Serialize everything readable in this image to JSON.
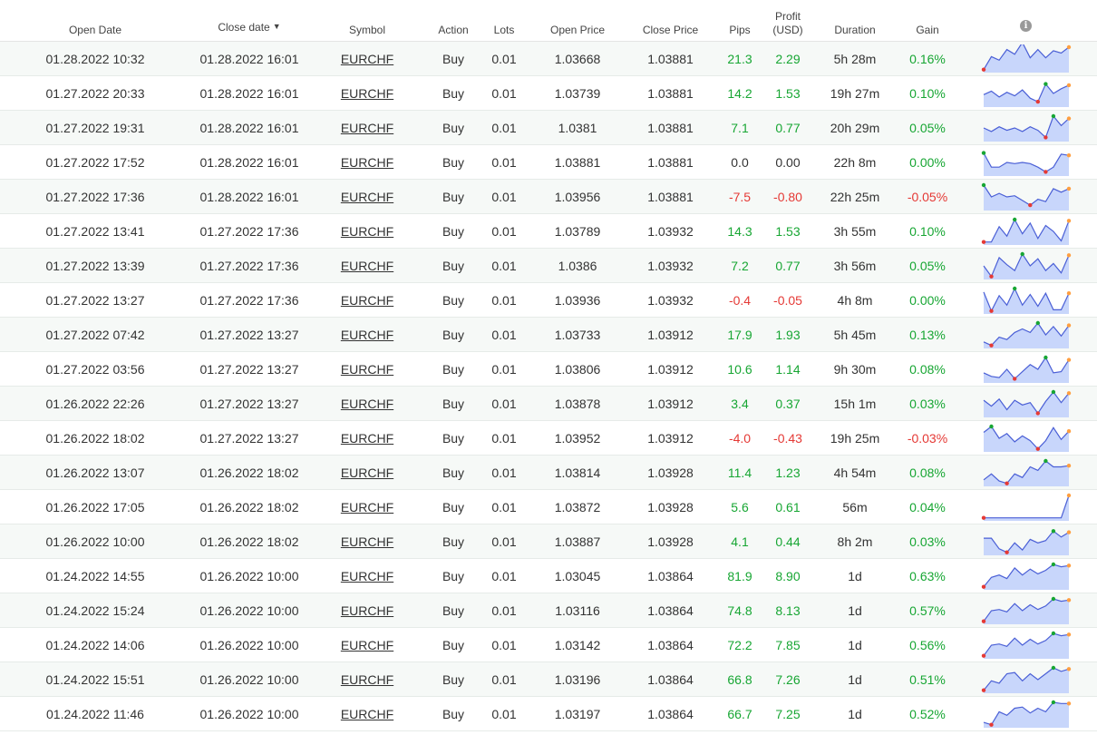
{
  "colors": {
    "positive": "#17a633",
    "negative": "#e53935",
    "spark_fill": "#c8d6fb",
    "spark_line": "#4a5fd6",
    "spark_min": "#e53935",
    "spark_max": "#17a633",
    "spark_end": "#ff9f40"
  },
  "headers": {
    "open_date": "Open Date",
    "close_date": "Close date",
    "close_sort_icon": "▼",
    "symbol": "Symbol",
    "action": "Action",
    "lots": "Lots",
    "open_price": "Open Price",
    "close_price": "Close Price",
    "pips": "Pips",
    "profit_line1": "Profit",
    "profit_line2": "(USD)",
    "duration": "Duration",
    "gain": "Gain",
    "info_icon": "i"
  },
  "trades": [
    {
      "open_date": "01.28.2022 10:32",
      "close_date": "01.28.2022 16:01",
      "symbol": "EURCHF",
      "action": "Buy",
      "lots": "0.01",
      "open_price": "1.03668",
      "close_price": "1.03881",
      "pips": "21.3",
      "profit": "2.29",
      "duration": "5h 28m",
      "gain": "0.16%",
      "sign": "pos",
      "spark": [
        0.05,
        0.6,
        0.45,
        0.9,
        0.7,
        1.2,
        0.55,
        0.9,
        0.55,
        0.85,
        0.75,
        1.0
      ]
    },
    {
      "open_date": "01.27.2022 20:33",
      "close_date": "01.28.2022 16:01",
      "symbol": "EURCHF",
      "action": "Buy",
      "lots": "0.01",
      "open_price": "1.03739",
      "close_price": "1.03881",
      "pips": "14.2",
      "profit": "1.53",
      "duration": "19h 27m",
      "gain": "0.10%",
      "sign": "pos",
      "spark": [
        0.45,
        0.6,
        0.35,
        0.55,
        0.4,
        0.65,
        0.3,
        0.15,
        0.9,
        0.5,
        0.7,
        0.85
      ]
    },
    {
      "open_date": "01.27.2022 19:31",
      "close_date": "01.28.2022 16:01",
      "symbol": "EURCHF",
      "action": "Buy",
      "lots": "0.01",
      "open_price": "1.0381",
      "close_price": "1.03881",
      "pips": "7.1",
      "profit": "0.77",
      "duration": "20h 29m",
      "gain": "0.05%",
      "sign": "pos",
      "spark": [
        0.5,
        0.35,
        0.55,
        0.4,
        0.5,
        0.35,
        0.55,
        0.4,
        0.1,
        1.0,
        0.6,
        0.9
      ]
    },
    {
      "open_date": "01.27.2022 17:52",
      "close_date": "01.28.2022 16:01",
      "symbol": "EURCHF",
      "action": "Buy",
      "lots": "0.01",
      "open_price": "1.03881",
      "close_price": "1.03881",
      "pips": "0.0",
      "profit": "0.00",
      "duration": "22h 8m",
      "gain": "0.00%",
      "sign": "neu",
      "spark": [
        0.9,
        0.3,
        0.3,
        0.5,
        0.45,
        0.5,
        0.45,
        0.3,
        0.1,
        0.3,
        0.85,
        0.8
      ]
    },
    {
      "open_date": "01.27.2022 17:36",
      "close_date": "01.28.2022 16:01",
      "symbol": "EURCHF",
      "action": "Buy",
      "lots": "0.01",
      "open_price": "1.03956",
      "close_price": "1.03881",
      "pips": "-7.5",
      "profit": "-0.80",
      "duration": "22h 25m",
      "gain": "-0.05%",
      "sign": "neg",
      "spark": [
        1.0,
        0.5,
        0.65,
        0.5,
        0.55,
        0.35,
        0.15,
        0.4,
        0.3,
        0.85,
        0.7,
        0.85
      ]
    },
    {
      "open_date": "01.27.2022 13:41",
      "close_date": "01.27.2022 17:36",
      "symbol": "EURCHF",
      "action": "Buy",
      "lots": "0.01",
      "open_price": "1.03789",
      "close_price": "1.03932",
      "pips": "14.3",
      "profit": "1.53",
      "duration": "3h 55m",
      "gain": "0.10%",
      "sign": "pos",
      "spark": [
        0.05,
        0.05,
        0.7,
        0.3,
        1.0,
        0.4,
        0.85,
        0.2,
        0.75,
        0.5,
        0.1,
        0.95
      ]
    },
    {
      "open_date": "01.27.2022 13:39",
      "close_date": "01.27.2022 17:36",
      "symbol": "EURCHF",
      "action": "Buy",
      "lots": "0.01",
      "open_price": "1.0386",
      "close_price": "1.03932",
      "pips": "7.2",
      "profit": "0.77",
      "duration": "3h 56m",
      "gain": "0.05%",
      "sign": "pos",
      "spark": [
        0.5,
        0.05,
        0.85,
        0.55,
        0.3,
        1.0,
        0.5,
        0.8,
        0.3,
        0.6,
        0.2,
        0.95
      ]
    },
    {
      "open_date": "01.27.2022 13:27",
      "close_date": "01.27.2022 17:36",
      "symbol": "EURCHF",
      "action": "Buy",
      "lots": "0.01",
      "open_price": "1.03936",
      "close_price": "1.03932",
      "pips": "-0.4",
      "profit": "-0.05",
      "duration": "4h 8m",
      "gain": "0.00%",
      "sign": "neg",
      "spark": [
        0.85,
        0.05,
        0.7,
        0.3,
        1.0,
        0.3,
        0.75,
        0.25,
        0.8,
        0.1,
        0.1,
        0.8
      ]
    },
    {
      "open_date": "01.27.2022 07:42",
      "close_date": "01.27.2022 13:27",
      "symbol": "EURCHF",
      "action": "Buy",
      "lots": "0.01",
      "open_price": "1.03733",
      "close_price": "1.03912",
      "pips": "17.9",
      "profit": "1.93",
      "duration": "5h 45m",
      "gain": "0.13%",
      "sign": "pos",
      "spark": [
        0.2,
        0.05,
        0.4,
        0.3,
        0.6,
        0.75,
        0.6,
        1.0,
        0.5,
        0.85,
        0.45,
        0.9
      ]
    },
    {
      "open_date": "01.27.2022 03:56",
      "close_date": "01.27.2022 13:27",
      "symbol": "EURCHF",
      "action": "Buy",
      "lots": "0.01",
      "open_price": "1.03806",
      "close_price": "1.03912",
      "pips": "10.6",
      "profit": "1.14",
      "duration": "9h 30m",
      "gain": "0.08%",
      "sign": "pos",
      "spark": [
        0.35,
        0.2,
        0.15,
        0.5,
        0.1,
        0.4,
        0.7,
        0.5,
        1.0,
        0.35,
        0.4,
        0.9
      ]
    },
    {
      "open_date": "01.26.2022 22:26",
      "close_date": "01.27.2022 13:27",
      "symbol": "EURCHF",
      "action": "Buy",
      "lots": "0.01",
      "open_price": "1.03878",
      "close_price": "1.03912",
      "pips": "3.4",
      "profit": "0.37",
      "duration": "15h 1m",
      "gain": "0.03%",
      "sign": "pos",
      "spark": [
        0.65,
        0.4,
        0.7,
        0.25,
        0.65,
        0.45,
        0.55,
        0.1,
        0.6,
        1.0,
        0.55,
        0.95
      ]
    },
    {
      "open_date": "01.26.2022 18:02",
      "close_date": "01.27.2022 13:27",
      "symbol": "EURCHF",
      "action": "Buy",
      "lots": "0.01",
      "open_price": "1.03952",
      "close_price": "1.03912",
      "pips": "-4.0",
      "profit": "-0.43",
      "duration": "19h 25m",
      "gain": "-0.03%",
      "sign": "neg",
      "spark": [
        0.75,
        1.0,
        0.5,
        0.7,
        0.35,
        0.6,
        0.4,
        0.05,
        0.4,
        0.95,
        0.45,
        0.8
      ]
    },
    {
      "open_date": "01.26.2022 13:07",
      "close_date": "01.26.2022 18:02",
      "symbol": "EURCHF",
      "action": "Buy",
      "lots": "0.01",
      "open_price": "1.03814",
      "close_price": "1.03928",
      "pips": "11.4",
      "profit": "1.23",
      "duration": "4h 54m",
      "gain": "0.08%",
      "sign": "pos",
      "spark": [
        0.2,
        0.45,
        0.15,
        0.05,
        0.45,
        0.3,
        0.75,
        0.6,
        1.0,
        0.75,
        0.75,
        0.8
      ]
    },
    {
      "open_date": "01.26.2022 17:05",
      "close_date": "01.26.2022 18:02",
      "symbol": "EURCHF",
      "action": "Buy",
      "lots": "0.01",
      "open_price": "1.03872",
      "close_price": "1.03928",
      "pips": "5.6",
      "profit": "0.61",
      "duration": "56m",
      "gain": "0.04%",
      "sign": "pos",
      "spark": [
        0.05,
        0.05,
        0.05,
        0.05,
        0.05,
        0.05,
        0.05,
        0.05,
        0.05,
        0.05,
        0.05,
        1.0
      ]
    },
    {
      "open_date": "01.26.2022 10:00",
      "close_date": "01.26.2022 18:02",
      "symbol": "EURCHF",
      "action": "Buy",
      "lots": "0.01",
      "open_price": "1.03887",
      "close_price": "1.03928",
      "pips": "4.1",
      "profit": "0.44",
      "duration": "8h 2m",
      "gain": "0.03%",
      "sign": "pos",
      "spark": [
        0.65,
        0.65,
        0.2,
        0.05,
        0.45,
        0.15,
        0.6,
        0.45,
        0.55,
        0.95,
        0.7,
        0.9
      ]
    },
    {
      "open_date": "01.24.2022 14:55",
      "close_date": "01.26.2022 10:00",
      "symbol": "EURCHF",
      "action": "Buy",
      "lots": "0.01",
      "open_price": "1.03045",
      "close_price": "1.03864",
      "pips": "81.9",
      "profit": "8.90",
      "duration": "1d",
      "gain": "0.63%",
      "sign": "pos",
      "spark": [
        0.05,
        0.45,
        0.55,
        0.4,
        0.85,
        0.55,
        0.8,
        0.6,
        0.75,
        1.0,
        0.9,
        0.95
      ]
    },
    {
      "open_date": "01.24.2022 15:24",
      "close_date": "01.26.2022 10:00",
      "symbol": "EURCHF",
      "action": "Buy",
      "lots": "0.01",
      "open_price": "1.03116",
      "close_price": "1.03864",
      "pips": "74.8",
      "profit": "8.13",
      "duration": "1d",
      "gain": "0.57%",
      "sign": "pos",
      "spark": [
        0.05,
        0.5,
        0.55,
        0.45,
        0.8,
        0.5,
        0.75,
        0.55,
        0.7,
        1.0,
        0.9,
        0.95
      ]
    },
    {
      "open_date": "01.24.2022 14:06",
      "close_date": "01.26.2022 10:00",
      "symbol": "EURCHF",
      "action": "Buy",
      "lots": "0.01",
      "open_price": "1.03142",
      "close_price": "1.03864",
      "pips": "72.2",
      "profit": "7.85",
      "duration": "1d",
      "gain": "0.56%",
      "sign": "pos",
      "spark": [
        0.05,
        0.5,
        0.55,
        0.45,
        0.8,
        0.5,
        0.75,
        0.55,
        0.7,
        1.0,
        0.9,
        0.95
      ]
    },
    {
      "open_date": "01.24.2022 15:51",
      "close_date": "01.26.2022 10:00",
      "symbol": "EURCHF",
      "action": "Buy",
      "lots": "0.01",
      "open_price": "1.03196",
      "close_price": "1.03864",
      "pips": "66.8",
      "profit": "7.26",
      "duration": "1d",
      "gain": "0.51%",
      "sign": "pos",
      "spark": [
        0.05,
        0.45,
        0.35,
        0.75,
        0.8,
        0.45,
        0.75,
        0.5,
        0.75,
        1.0,
        0.85,
        0.95
      ]
    },
    {
      "open_date": "01.24.2022 11:46",
      "close_date": "01.26.2022 10:00",
      "symbol": "EURCHF",
      "action": "Buy",
      "lots": "0.01",
      "open_price": "1.03197",
      "close_price": "1.03864",
      "pips": "66.7",
      "profit": "7.25",
      "duration": "1d",
      "gain": "0.52%",
      "sign": "pos",
      "spark": [
        0.15,
        0.05,
        0.6,
        0.45,
        0.75,
        0.8,
        0.55,
        0.75,
        0.6,
        1.0,
        0.95,
        0.95
      ]
    }
  ]
}
